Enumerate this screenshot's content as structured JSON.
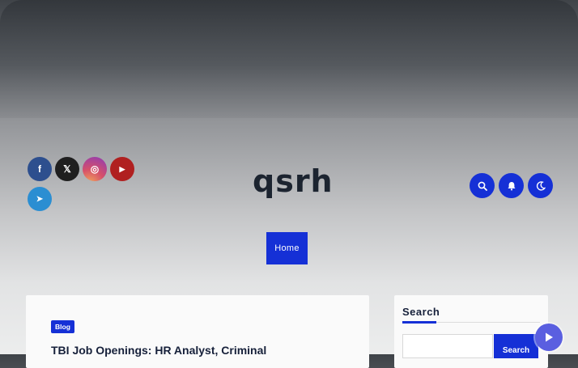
{
  "site": {
    "title": "qsrh"
  },
  "social": [
    {
      "name": "facebook",
      "icon": "facebook-icon",
      "glyph": "f"
    },
    {
      "name": "x",
      "icon": "x-icon",
      "glyph": "𝕏"
    },
    {
      "name": "instagram",
      "icon": "instagram-icon",
      "glyph": "◎"
    },
    {
      "name": "youtube",
      "icon": "youtube-icon",
      "glyph": "▶"
    },
    {
      "name": "telegram",
      "icon": "telegram-icon",
      "glyph": "➤"
    }
  ],
  "header_actions": [
    "search-icon",
    "bell-icon",
    "moon-icon"
  ],
  "nav": {
    "home_label": "Home"
  },
  "post": {
    "category": "Blog",
    "title": "TBI Job Openings: HR Analyst, Criminal"
  },
  "sidebar": {
    "search_title": "Search",
    "search_button": "Search",
    "search_placeholder": ""
  },
  "colors": {
    "accent": "#1530d6",
    "play_button": "#5a5fe0"
  }
}
